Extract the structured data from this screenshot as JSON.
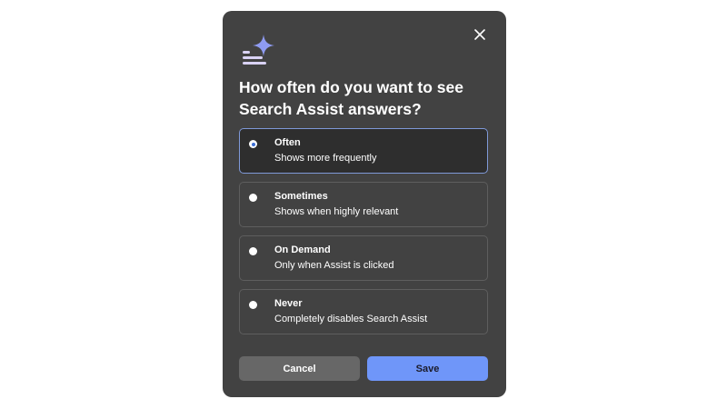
{
  "dialog": {
    "title": "How often do you want to see Search Assist answers?",
    "icon": "sparkle-assist-icon",
    "close_icon": "close-icon",
    "accent_color": "#6f96f9",
    "background_color": "#424242"
  },
  "options": [
    {
      "label": "Often",
      "description": "Shows more frequently",
      "selected": true
    },
    {
      "label": "Sometimes",
      "description": "Shows when highly relevant",
      "selected": false
    },
    {
      "label": "On Demand",
      "description": "Only when Assist is clicked",
      "selected": false
    },
    {
      "label": "Never",
      "description": "Completely disables Search Assist",
      "selected": false
    }
  ],
  "buttons": {
    "cancel_label": "Cancel",
    "save_label": "Save"
  }
}
